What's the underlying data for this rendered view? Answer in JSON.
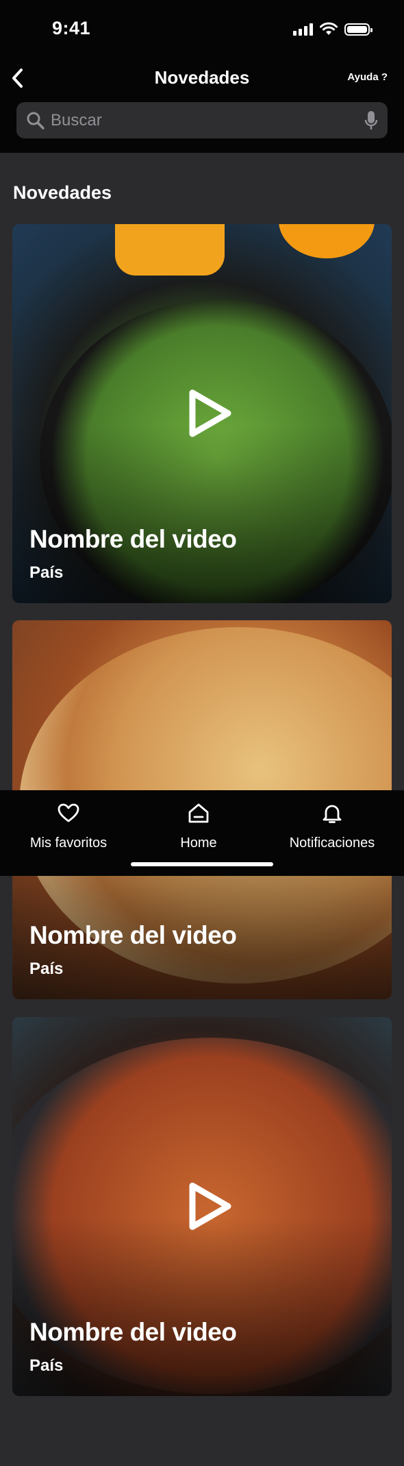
{
  "status_bar": {
    "time": "9:41"
  },
  "nav": {
    "title": "Novedades",
    "help_label": "Ayuda ?"
  },
  "search": {
    "placeholder": "Buscar"
  },
  "section": {
    "title": "Novedades"
  },
  "videos": [
    {
      "title": "Nombre del video",
      "country": "País"
    },
    {
      "title": "Nombre del video",
      "country": "País"
    },
    {
      "title": "Nombre del video",
      "country": "País"
    }
  ],
  "tabbar": {
    "items": [
      {
        "label": "Mis favoritos",
        "icon": "heart-icon"
      },
      {
        "label": "Home",
        "icon": "home-icon"
      },
      {
        "label": "Notificaciones",
        "icon": "bell-icon"
      }
    ]
  }
}
